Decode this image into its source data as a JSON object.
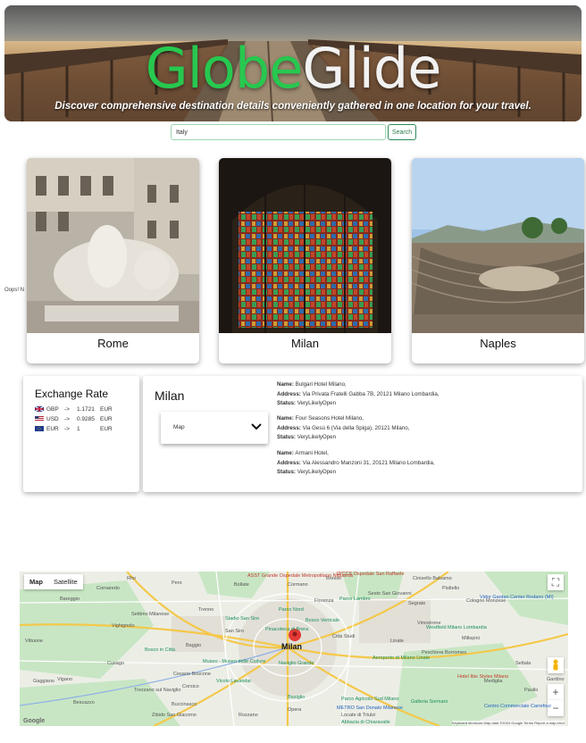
{
  "hero": {
    "title_part1": "Globe",
    "title_part2": "Glide",
    "subtitle": "Discover comprehensive destination details conveniently gathered in one location for your travel."
  },
  "search": {
    "value": "Italy",
    "button_label": "Search"
  },
  "cards": [
    {
      "name": "Rome"
    },
    {
      "name": "Milan"
    },
    {
      "name": "Naples"
    }
  ],
  "error_text": "Oops! N",
  "exchange": {
    "title": "Exchange Rate",
    "rates": [
      {
        "code": "GBP",
        "arrow": "->",
        "value": "1.1721",
        "target": "EUR",
        "flag": "uk"
      },
      {
        "code": "USD",
        "arrow": "->",
        "value": "0.9285",
        "target": "EUR",
        "flag": "us"
      },
      {
        "code": "EUR",
        "arrow": "->",
        "value": "1",
        "target": "EUR",
        "flag": "eu"
      }
    ]
  },
  "info": {
    "city": "Milan",
    "select_label": "Map",
    "hotels": [
      {
        "name_label": "Name:",
        "name": "Bulgari Hotel Milano,",
        "address_label": "Address:",
        "address": "Via Privata Fratelli Gabba 7B, 20121 Milano Lombardia,",
        "status_label": "Status:",
        "status": "VeryLikelyOpen"
      },
      {
        "name_label": "Name:",
        "name": "Four Seasons Hotel Milano,",
        "address_label": "Address:",
        "address": "Via Gesù 6 (Via della Spiga), 20121 Milano,",
        "status_label": "Status:",
        "status": "VeryLikelyOpen"
      },
      {
        "name_label": "Name:",
        "name": "Armani Hotel,",
        "address_label": "Address:",
        "address": "Via Alessandro Manzoni 31, 20121 Milano Lombardia,",
        "status_label": "Status:",
        "status": "VeryLikelyOpen"
      }
    ]
  },
  "map": {
    "tab_map": "Map",
    "tab_satellite": "Satellite",
    "city_label": "Milan",
    "labels": [
      "Cornaredo",
      "Bareggio",
      "Settimo Milanese",
      "Vighignolo",
      "Cusago",
      "Vittuone",
      "Trezzano sul Naviglio",
      "Corsico",
      "Buccinasco",
      "Zibido San Giacomo",
      "Bescazzo",
      "Gaggiano",
      "Vigano",
      "Cesano Boscone",
      "Pero",
      "Rho",
      "Bollate",
      "Cormano",
      "Bresso",
      "Cinisello Balsamo",
      "Sesto San Giovanni",
      "Cologno Monzese",
      "Segrate",
      "Pioltello",
      "Vimodrone",
      "Peschiera Borromeo",
      "Mediglia",
      "Paullo",
      "Millepini",
      "Settala",
      "Opera",
      "Rozzano",
      "Gardino",
      "Locate di Triulzi",
      "Linate",
      "Trenno",
      "Baggio",
      "San Siro",
      "Città Studi",
      "Fiorenza"
    ],
    "poi": [
      "Stadio San Siro",
      "Pinacoteca di Brera",
      "Museo - Museo delle Culture",
      "Naviglio Grande",
      "Aeroporto di Milano Linate",
      "Westfield Milano Lombardia",
      "Parco Lambro",
      "Bosco in Città",
      "Parco Agricolo Sud Milano",
      "Basiglio",
      "Galleria Sormani",
      "Abbazia di Chiaravalle",
      "Vicolo Lavandai",
      "Parco Nord",
      "Bosco Verticale"
    ],
    "red_labels": [
      "ASST Grande Ospedale Metropolitano Niguarda",
      "IRCCS Ospedale San Raffaele",
      "Hotel Ibis Styles Milano"
    ],
    "blue_labels": [
      "Vidor Garden Center Rodano (MI)",
      "Centro Commerciale Carrefour",
      "METRO San Donato Milanese"
    ],
    "zoom_in": "+",
    "zoom_out": "−",
    "fullscreen": "⛶",
    "logo": "Google",
    "attribution": "Keyboard shortcuts   Map data ©2024 Google   Terms   Report a map error"
  }
}
